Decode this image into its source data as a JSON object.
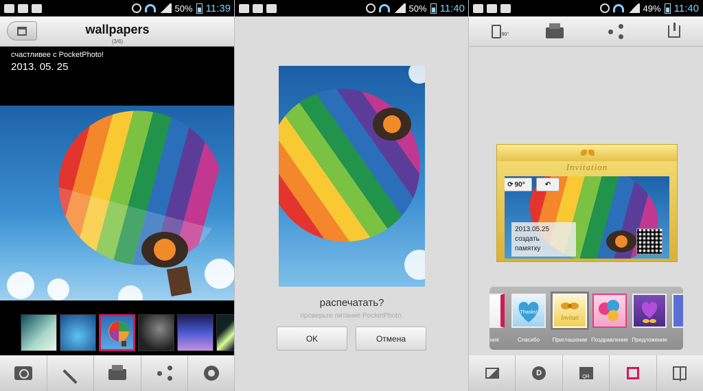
{
  "panel1": {
    "status": {
      "battery": "50%",
      "time": "11:39"
    },
    "header": {
      "title": "wallpapers",
      "count": "(3/6)"
    },
    "caption": "счастливее с PocketPhoto!",
    "date": "2013. 05. 25",
    "thumbnails": [
      "thumb-1",
      "thumb-2",
      "thumb-3",
      "thumb-4",
      "thumb-5",
      "thumb-6"
    ],
    "selected_thumbnail": 3,
    "toolbar": [
      "camera-icon",
      "magic-wand-icon",
      "printer-icon",
      "share-icon",
      "settings-gear-icon"
    ]
  },
  "panel2": {
    "status": {
      "battery": "50%",
      "time": "11:40"
    },
    "question": "распечатать?",
    "hint": "проверьте питание PocketPhoto.",
    "ok_label": "OK",
    "cancel_label": "Отмена"
  },
  "panel3": {
    "status": {
      "battery": "49%",
      "time": "11:40"
    },
    "toolbar": [
      "rotate-90-icon",
      "printer-icon",
      "share-icon",
      "download-icon"
    ],
    "card": {
      "title": "Invitation",
      "rotate_label": "90°",
      "date": "2013.05.25",
      "note_line1": "создать",
      "note_line2": "памятку"
    },
    "frames": [
      {
        "label": "ния"
      },
      {
        "label": "Спасибо",
        "inner": "Thanks!"
      },
      {
        "label": "Приглашение",
        "inner": "Invitati"
      },
      {
        "label": "Поздравление"
      },
      {
        "label": "Предложение"
      }
    ],
    "selected_frame": 2,
    "bottom_tabs": [
      "image-icon",
      "d-badge-icon",
      "qr-icon",
      "frame-icon",
      "layout-icon"
    ],
    "bottom_qr_label": "QR",
    "bottom_d_label": "D"
  },
  "colors": {
    "accent": "#d3185a",
    "sky": "#3a8fd0",
    "gold": "#e5c24a"
  }
}
